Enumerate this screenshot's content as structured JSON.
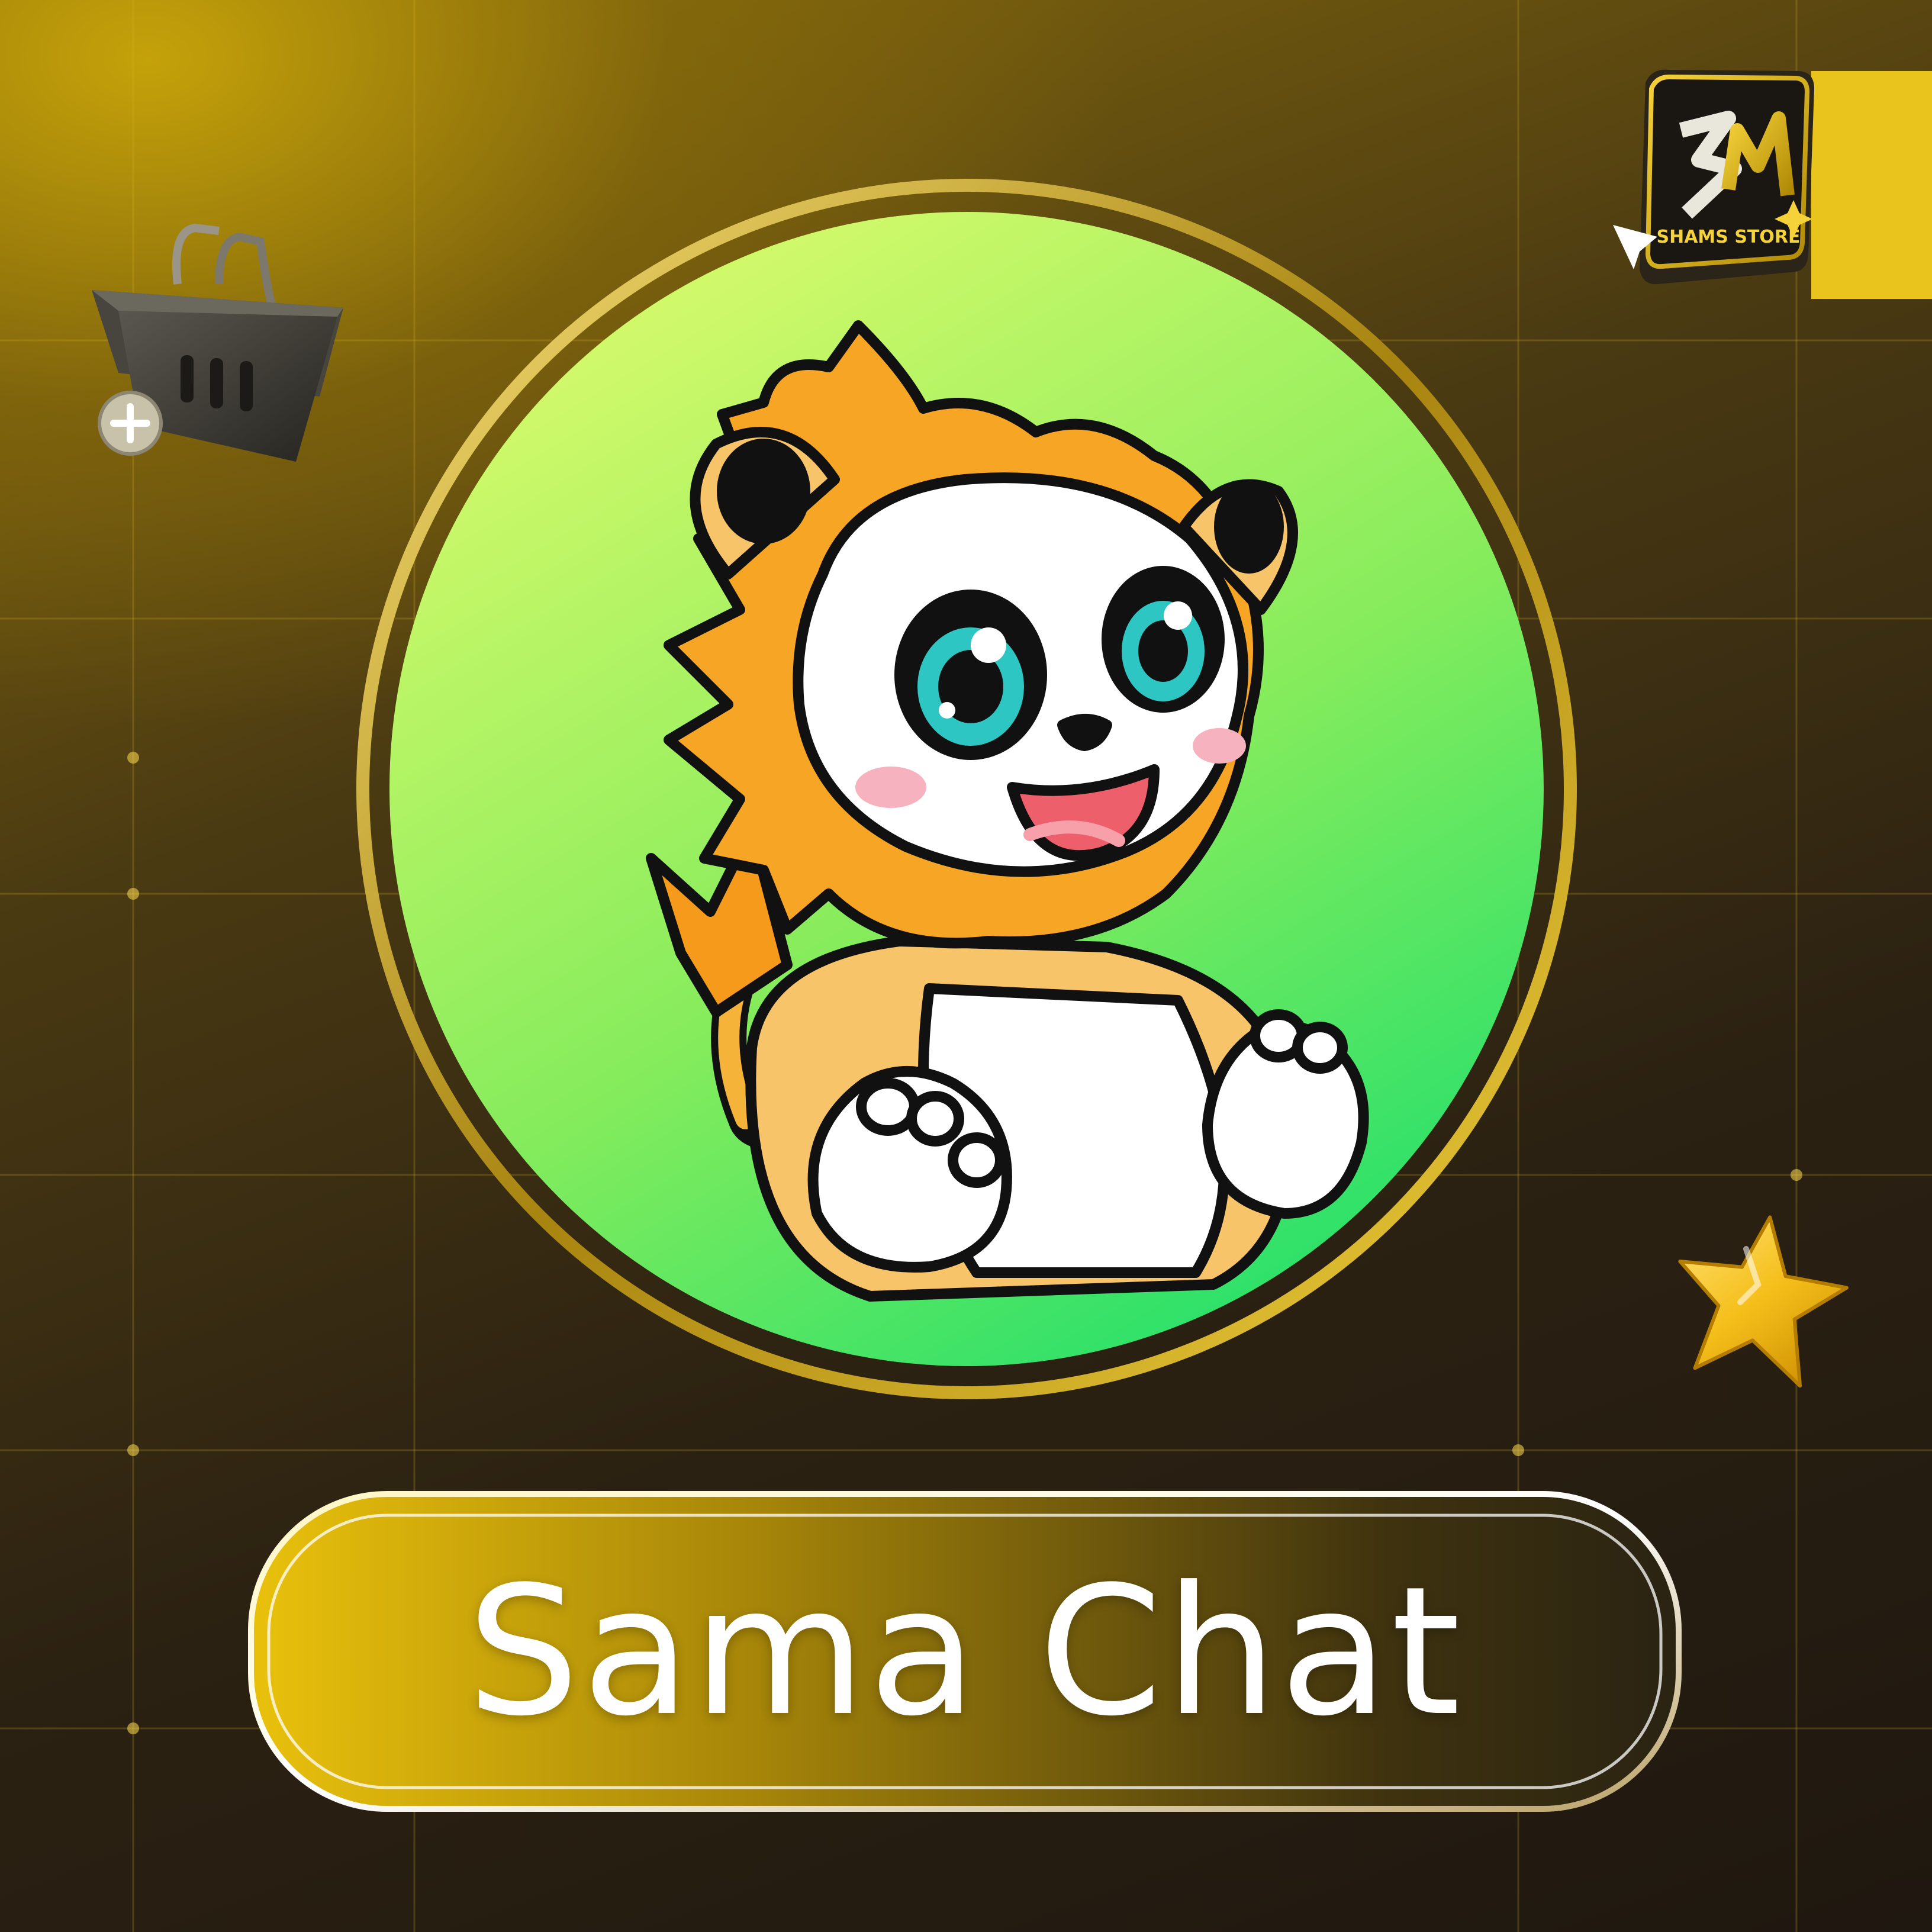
{
  "title": "Sama Chat",
  "brand": {
    "logo_text": "SHAMS STORE",
    "logo_monogram": "SM"
  },
  "icons": {
    "basket": "shopping-basket-add-icon",
    "star": "star-icon",
    "mascot": "lion-cub-mascot"
  },
  "colors": {
    "gold": "#d9b20a",
    "dark_bg": "#231a10",
    "circle_green_top": "#d8fb6a",
    "circle_green_bottom": "#22e06e",
    "lion_orange": "#f6a524",
    "text": "#ffffff"
  }
}
